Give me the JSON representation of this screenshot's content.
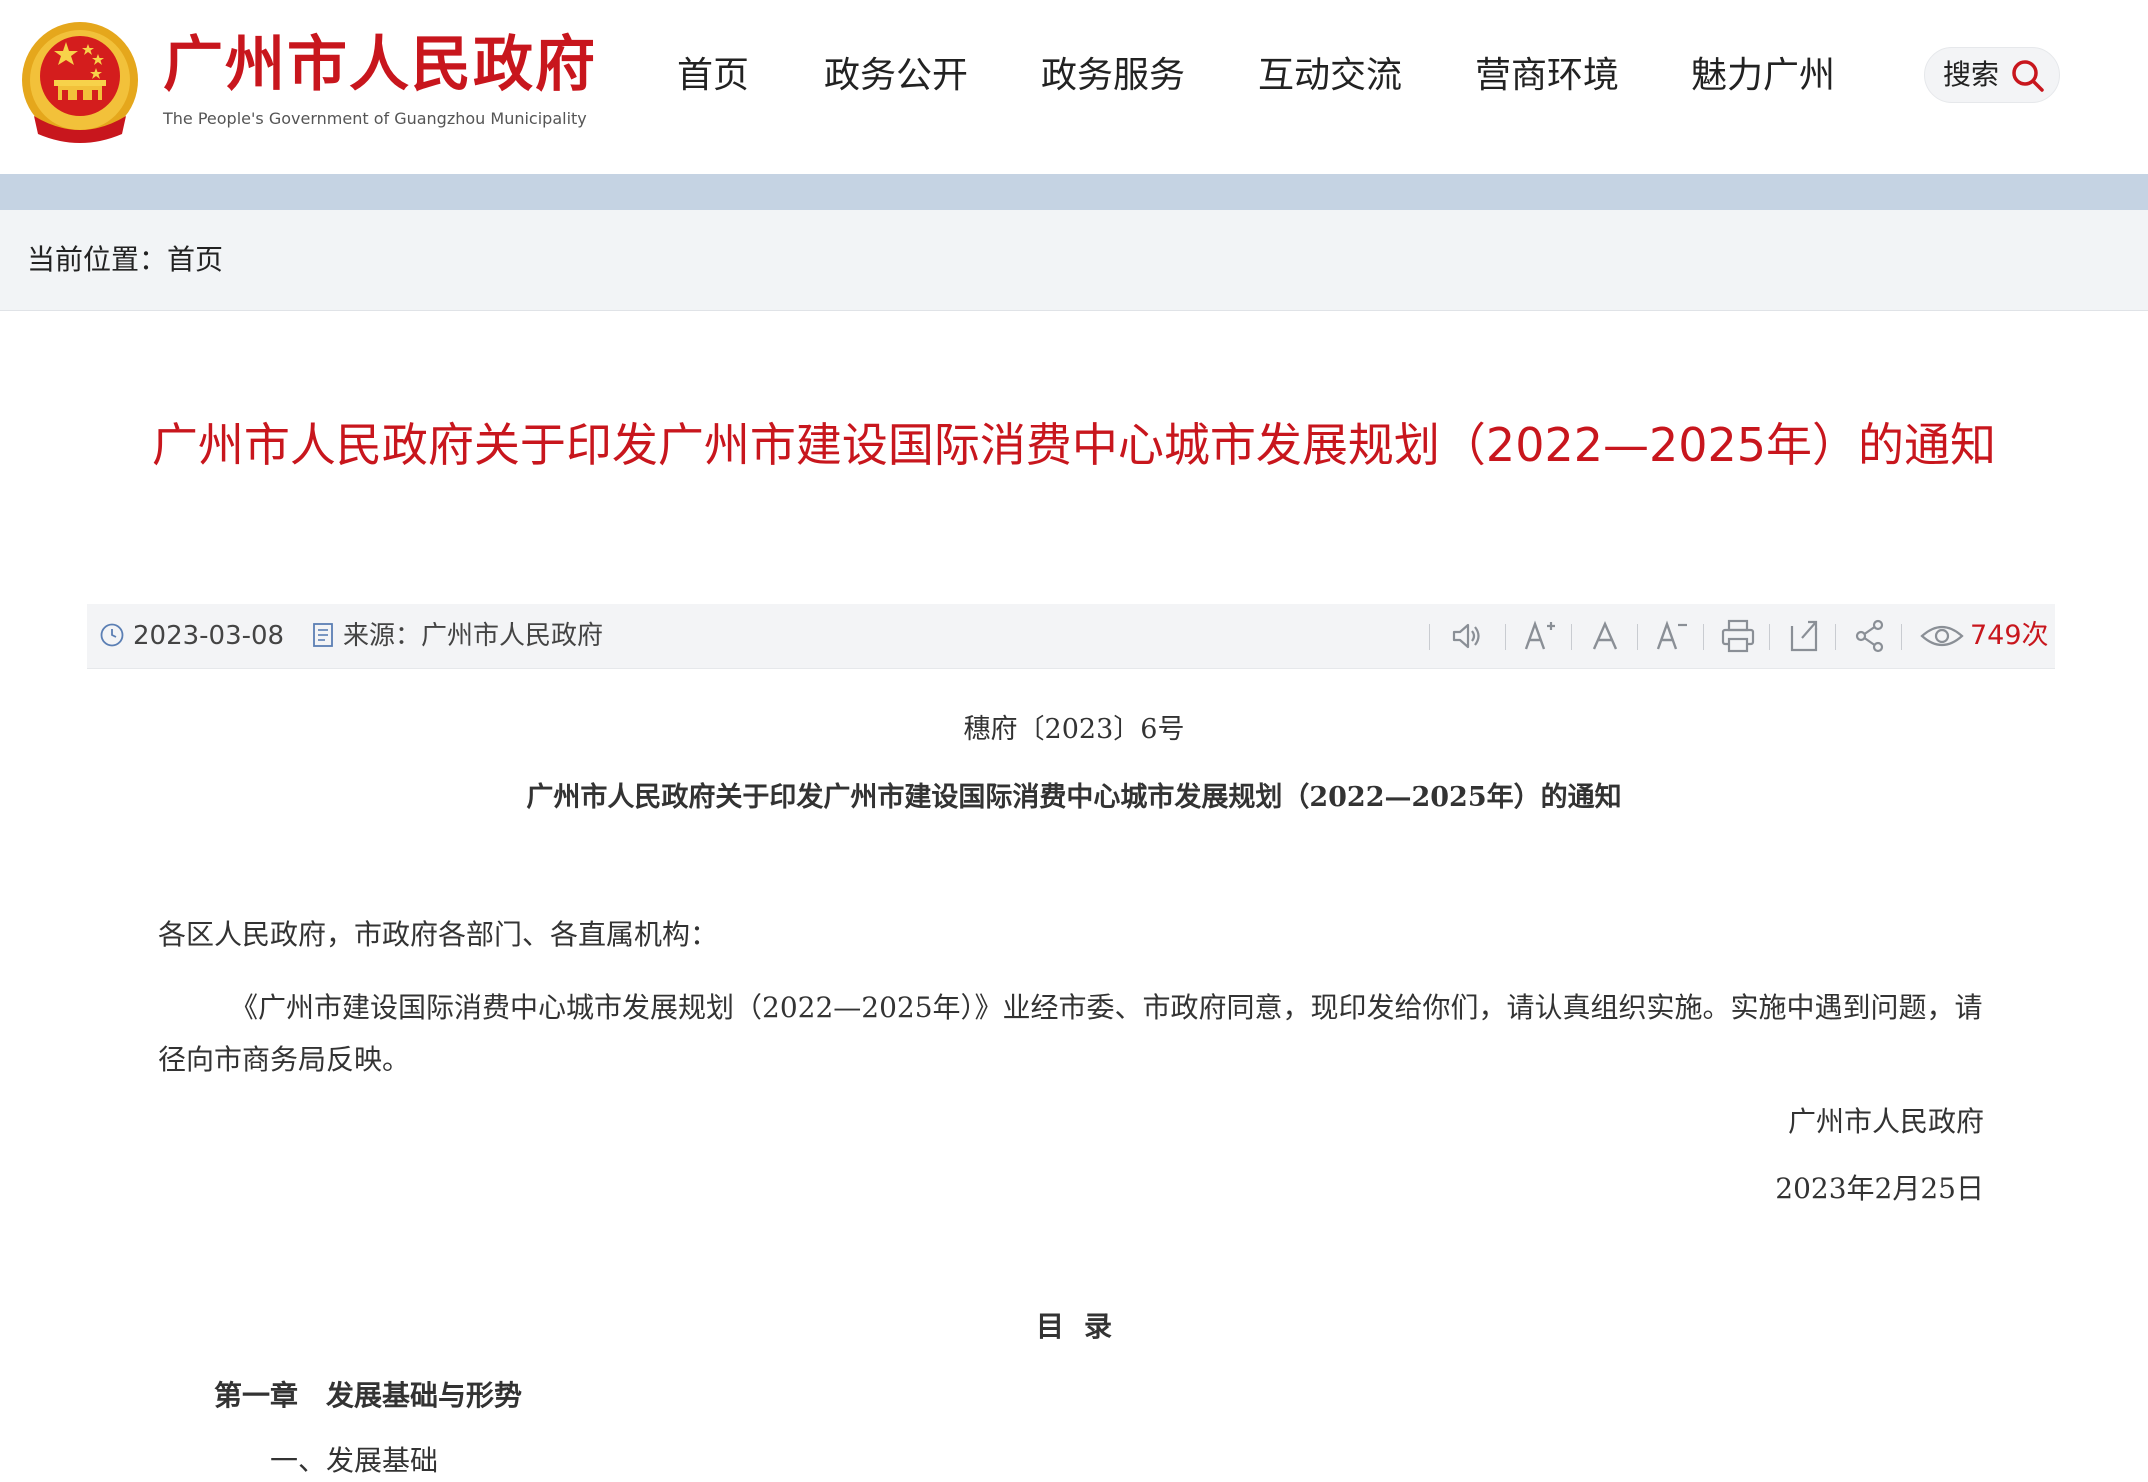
{
  "site": {
    "title": "广州市人民政府",
    "subtitle": "The People's Government of Guangzhou Municipality"
  },
  "nav": {
    "items": [
      "首页",
      "政务公开",
      "政务服务",
      "互动交流",
      "营商环境",
      "魅力广州"
    ],
    "search_label": "搜索"
  },
  "breadcrumb": {
    "prefix": "当前位置：",
    "home": "首页"
  },
  "article": {
    "title": "广州市人民政府关于印发广州市建设国际消费中心城市发展规划（2022—2025年）的通知",
    "date": "2023-03-08",
    "source": "来源：广州市人民政府",
    "views": "749次"
  },
  "toolbar": {
    "icons": [
      "speaker-icon",
      "font-increase-icon",
      "font-default-icon",
      "font-decrease-icon",
      "print-icon",
      "share-window-icon",
      "share-icon",
      "eye-icon"
    ]
  },
  "document": {
    "number": "穗府〔2023〕6号",
    "heading": "广州市人民政府关于印发广州市建设国际消费中心城市发展规划（2022—2025年）的通知",
    "salutation": "各区人民政府，市政府各部门、各直属机构：",
    "paragraph": "《广州市建设国际消费中心城市发展规划（2022—2025年）》业经市委、市政府同意，现印发给你们，请认真组织实施。实施中遇到问题，请径向市商务局反映。",
    "signer": "广州市人民政府",
    "sign_date": "2023年2月25日",
    "toc_title": "目录",
    "toc": [
      "第一章　发展基础与形势",
      "一、发展基础"
    ]
  },
  "colors": {
    "brand_red": "#c8161d",
    "band_blue": "#c5d3e3"
  }
}
